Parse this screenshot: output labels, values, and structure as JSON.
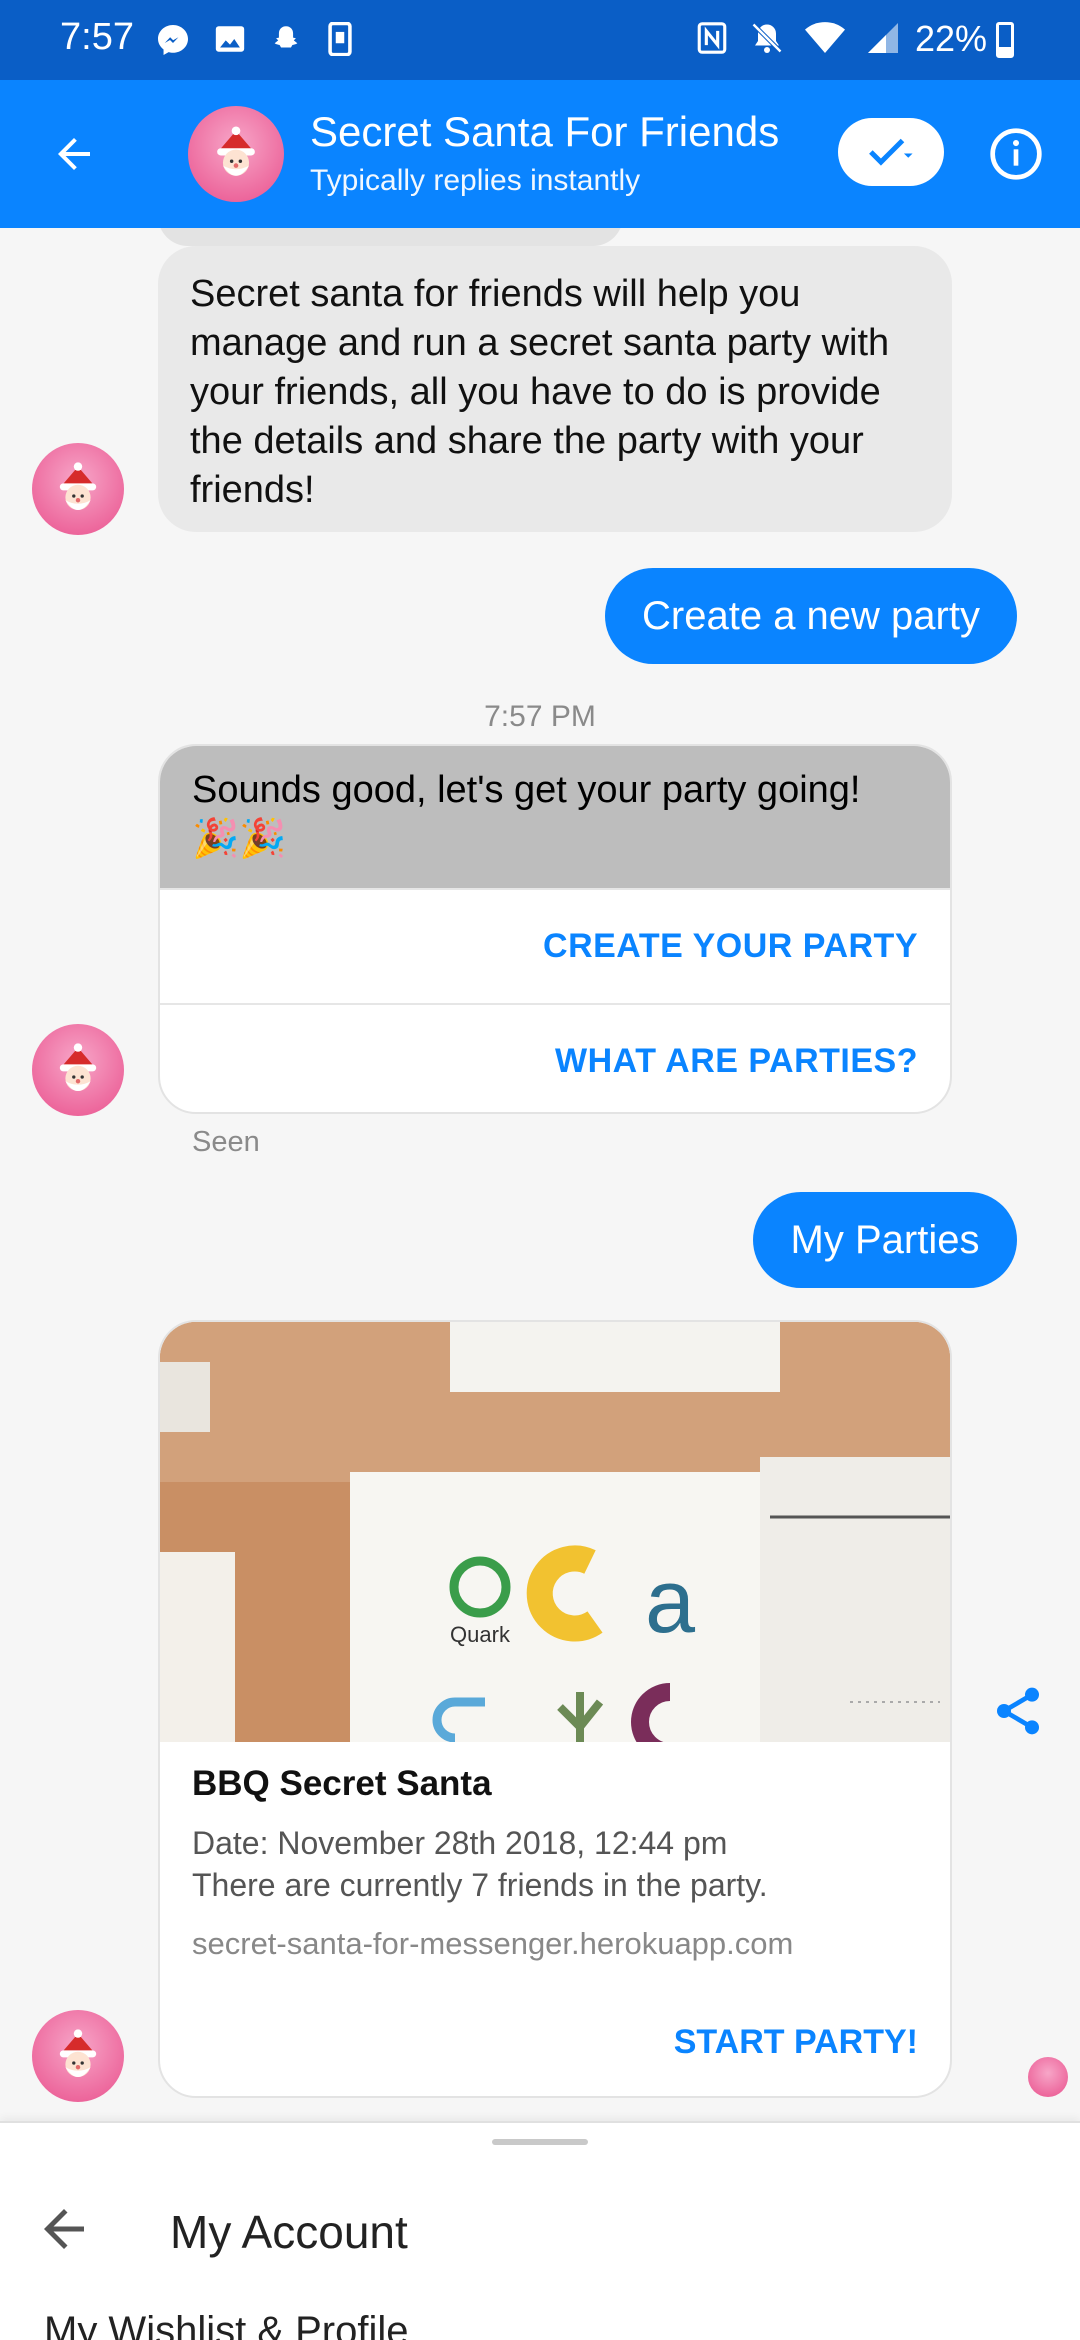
{
  "status_bar": {
    "time": "7:57",
    "battery": "22%",
    "left_icons": [
      "messenger-icon",
      "gallery-icon",
      "snapchat-icon",
      "phone-icon"
    ],
    "right_icons": [
      "nfc-icon",
      "mute-icon",
      "wifi-icon",
      "signal-icon",
      "battery-icon"
    ]
  },
  "header": {
    "title": "Secret Santa For Friends",
    "subtitle": "Typically replies instantly"
  },
  "messages": {
    "bot_intro": "Secret santa for friends will help you manage and run a secret santa party with your friends, all you have to do is provide the details and share the party with your friends!",
    "user_create": "Create a new party",
    "timestamp": "7:57 PM",
    "bot_reply": "Sounds good, let's get your party going! 🎉🎉",
    "btn_create": "CREATE YOUR PARTY",
    "btn_what": "WHAT ARE PARTIES?",
    "seen": "Seen",
    "user_parties": "My Parties"
  },
  "party_card": {
    "title": "BBQ Secret Santa",
    "date": "Date: November 28th 2018, 12:44 pm",
    "friends": "There are currently 7 friends in the party.",
    "domain": "secret-santa-for-messenger.herokuapp.com",
    "action": "START PARTY!",
    "image_text": "Quark"
  },
  "sheet": {
    "title": "My Account",
    "item": "My Wishlist & Profile"
  },
  "colors": {
    "status_bar": "#0a5ec6",
    "header": "#0a84ff",
    "accent": "#0a84ff",
    "bubble_gray": "#e9e9e9"
  }
}
